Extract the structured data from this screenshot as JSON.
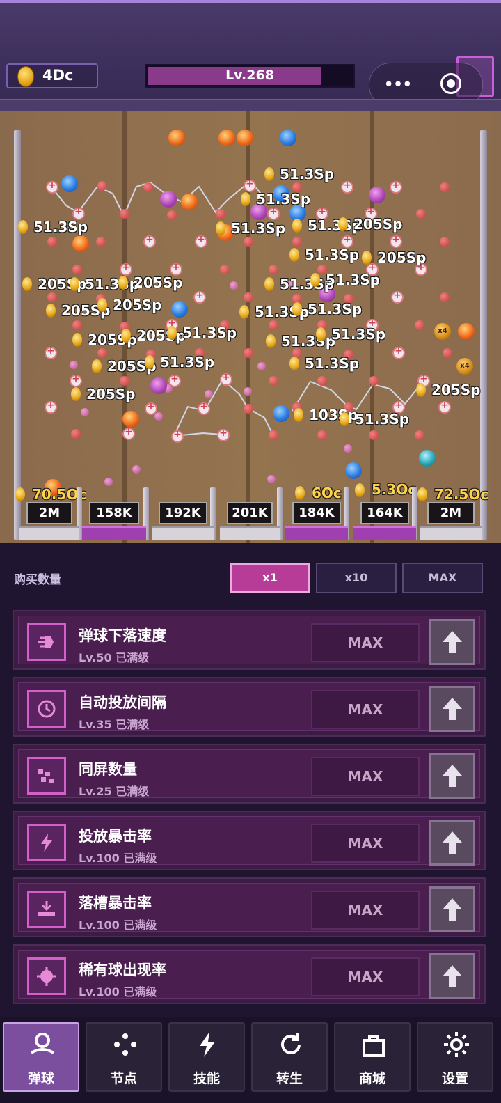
{
  "header": {
    "currency": "4Dc",
    "level_label": "Lv.268",
    "level_progress": 0.85
  },
  "board": {
    "popups": [
      {
        "text": "51.3Sp"
      },
      {
        "text": "51.3Sp"
      },
      {
        "text": "51.3Sp"
      },
      {
        "text": "51.3Sp"
      },
      {
        "text": "51.3Sp"
      },
      {
        "text": "205Sp"
      },
      {
        "text": "51.3Sp"
      },
      {
        "text": "205Sp"
      },
      {
        "text": "205Sp"
      },
      {
        "text": "51.3Sp"
      },
      {
        "text": "205Sp"
      },
      {
        "text": "51.3Sp"
      },
      {
        "text": "51.3Sp"
      },
      {
        "text": "205Sp"
      },
      {
        "text": "205Sp"
      },
      {
        "text": "51.3Sp"
      },
      {
        "text": "51.3Sp"
      },
      {
        "text": "205Sp"
      },
      {
        "text": "205Sp"
      },
      {
        "text": "51.3Sp"
      },
      {
        "text": "51.3Sp"
      },
      {
        "text": "51.3Sp"
      },
      {
        "text": "205Sp"
      },
      {
        "text": "51.3Sp"
      },
      {
        "text": "205Sp"
      },
      {
        "text": "51.3Sp"
      },
      {
        "text": "205Sp"
      },
      {
        "text": "103Sp"
      },
      {
        "text": "51.3Sp"
      }
    ],
    "slot_rewards": [
      "70.5Oc",
      "6Oc",
      "5.3Oc",
      "72.5Oc"
    ],
    "slots": [
      {
        "label": "2M",
        "highlight": false
      },
      {
        "label": "158K",
        "highlight": true
      },
      {
        "label": "192K",
        "highlight": false
      },
      {
        "label": "201K",
        "highlight": false
      },
      {
        "label": "184K",
        "highlight": true
      },
      {
        "label": "164K",
        "highlight": true
      },
      {
        "label": "2M",
        "highlight": false
      }
    ]
  },
  "buy": {
    "label": "购买数量",
    "options": [
      "x1",
      "x10",
      "MAX"
    ],
    "selected": "x1"
  },
  "upgrades": [
    {
      "title": "弹球下落速度",
      "sub": "Lv.50  已满级",
      "button": "MAX",
      "icon": "drop-speed-icon"
    },
    {
      "title": "自动投放间隔",
      "sub": "Lv.35  已满级",
      "button": "MAX",
      "icon": "timer-icon"
    },
    {
      "title": "同屏数量",
      "sub": "Lv.25  已满级",
      "button": "MAX",
      "icon": "balls-count-icon"
    },
    {
      "title": "投放暴击率",
      "sub": "Lv.100  已满级",
      "button": "MAX",
      "icon": "drop-crit-icon"
    },
    {
      "title": "落槽暴击率",
      "sub": "Lv.100  已满级",
      "button": "MAX",
      "icon": "slot-crit-icon"
    },
    {
      "title": "稀有球出现率",
      "sub": "Lv.100  已满级",
      "button": "MAX",
      "icon": "rare-ball-icon"
    }
  ],
  "nav": [
    {
      "label": "弹球",
      "icon": "pinball-icon",
      "active": true
    },
    {
      "label": "节点",
      "icon": "nodes-icon",
      "active": false
    },
    {
      "label": "技能",
      "icon": "lightning-icon",
      "active": false
    },
    {
      "label": "转生",
      "icon": "rebirth-icon",
      "active": false
    },
    {
      "label": "商城",
      "icon": "shop-icon",
      "active": false
    },
    {
      "label": "设置",
      "icon": "gear-icon",
      "active": false
    }
  ],
  "colors": {
    "accent": "#b63c98",
    "nav_active": "#7c4f9e",
    "panel_bg": "#1f1530"
  }
}
